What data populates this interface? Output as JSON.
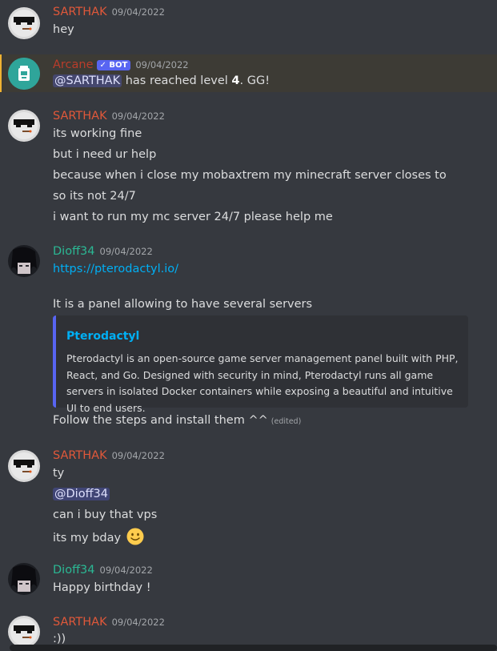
{
  "colors": {
    "sarthak": "#e0583a",
    "arcane": "#b93c2b",
    "dioff": "#2bb894",
    "link": "#00aff4",
    "highlight_bg": "#3d3b35",
    "highlight_bar": "#f0b232"
  },
  "messages": [
    {
      "author": "SARTHAK",
      "timestamp": "09/04/2022",
      "lines": [
        "hey"
      ]
    },
    {
      "author": "Arcane",
      "bot_badge": "✓ BOT",
      "timestamp": "09/04/2022",
      "mention": "@SARTHAK",
      "text_middle": " has reached level ",
      "level": "4",
      "text_end": ". GG!"
    },
    {
      "author": "SARTHAK",
      "timestamp": "09/04/2022",
      "lines": [
        "its working fine",
        "but i need ur help",
        "because when i close my mobaxtrem my minecraft server closes to",
        "so its not 24/7",
        "i want to run my mc server 24/7 please help me"
      ]
    },
    {
      "author": "Dioff34",
      "timestamp": "09/04/2022",
      "link": "https://pterodactyl.io/",
      "text": "It is a panel allowing to have several servers",
      "embed": {
        "title": "Pterodactyl",
        "description": "Pterodactyl is an open-source game server management panel built with PHP, React, and Go. Designed with security in mind, Pterodactyl runs all game servers in isolated Docker containers while exposing a beautiful and intuitive UI to end users."
      },
      "followup": "Follow the steps and install them ^^",
      "edited": "(edited)"
    },
    {
      "author": "SARTHAK",
      "timestamp": "09/04/2022",
      "lines": [
        "ty"
      ],
      "mention": "@Dioff34",
      "lines2": [
        "can i buy that vps",
        "its my bday"
      ],
      "emoji": "slightly-smiling-face"
    },
    {
      "author": "Dioff34",
      "timestamp": "09/04/2022",
      "lines": [
        "Happy birthday !"
      ]
    },
    {
      "author": "SARTHAK",
      "timestamp": "09/04/2022",
      "lines": [
        ":))"
      ]
    }
  ]
}
